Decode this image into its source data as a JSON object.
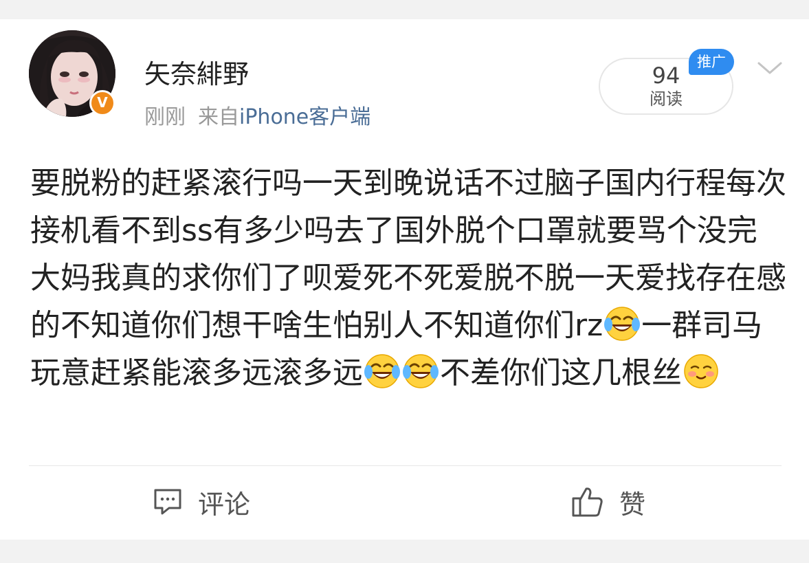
{
  "post": {
    "author": {
      "name": "矢奈緋野",
      "verified_badge": "V"
    },
    "meta": {
      "time": "刚刚",
      "source_prefix": "来自",
      "source_name": "iPhone客户端"
    },
    "reads": {
      "count": "94",
      "label": "阅读"
    },
    "promo_label": "推广",
    "content": [
      {
        "type": "text",
        "value": "要脱粉的赶紧滚行吗一天到晚说话不过脑子国内行程每次接机看不到ss有多少吗去了国外脱个口罩就要骂个没完大妈我真的求你们了呗爱死不死爱脱不脱一天爱找存在感的不知道你们想干啥生怕别人不知道你们rz"
      },
      {
        "type": "emoji",
        "name": "laugh-cry-emoji"
      },
      {
        "type": "text",
        "value": "一群司马玩意赶紧能滚多远滚多远"
      },
      {
        "type": "emoji",
        "name": "laugh-cry-emoji"
      },
      {
        "type": "emoji",
        "name": "laugh-cry-emoji"
      },
      {
        "type": "text",
        "value": "不差你们这几根丝"
      },
      {
        "type": "emoji",
        "name": "blushing-smile-emoji"
      }
    ],
    "text_segments": {
      "s1": "要脱粉的赶紧滚行吗一天到晚说话不过脑子国内行程每次接机看不到ss有多少吗去了国外脱个口罩就要骂个没完大妈我真的求你们了呗爱死不死爱脱不脱一天爱找存在感的不知道你们想干啥生怕别人不知道你们rz",
      "s2": "一群司马玩意赶紧能滚多远滚多远",
      "s3": "不差你们这几根丝"
    }
  },
  "actions": {
    "comment_label": "评论",
    "like_label": "赞"
  },
  "colors": {
    "source_link": "#4a6d96",
    "verified_badge": "#f08a19",
    "promo": "#2f8cf0",
    "text": "#222222",
    "muted": "#999999"
  }
}
